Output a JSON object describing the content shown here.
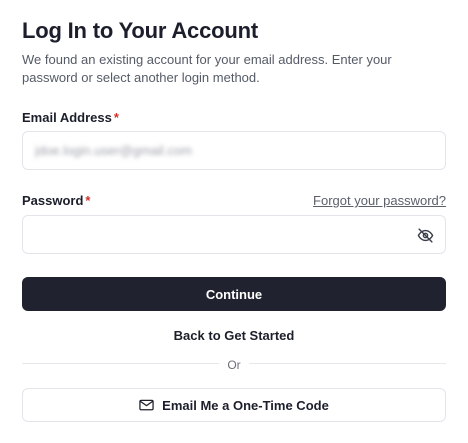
{
  "header": {
    "title": "Log In to Your Account",
    "subtitle": "We found an existing account for your email address. Enter your password or select another login method."
  },
  "email": {
    "label": "Email Address",
    "required_mark": "*",
    "value": "jdoe.login.user@gmail.com"
  },
  "password": {
    "label": "Password",
    "required_mark": "*",
    "value": "",
    "forgot_link": "Forgot your password?",
    "toggle_icon": "eye-off-icon"
  },
  "actions": {
    "continue_label": "Continue",
    "back_label": "Back to Get Started",
    "divider_text": "Or",
    "otp_label": "Email Me a One-Time Code",
    "otp_icon": "mail-icon"
  },
  "colors": {
    "primary_button": "#20232f",
    "required": "#d0312d",
    "border": "#e3e5ea"
  }
}
